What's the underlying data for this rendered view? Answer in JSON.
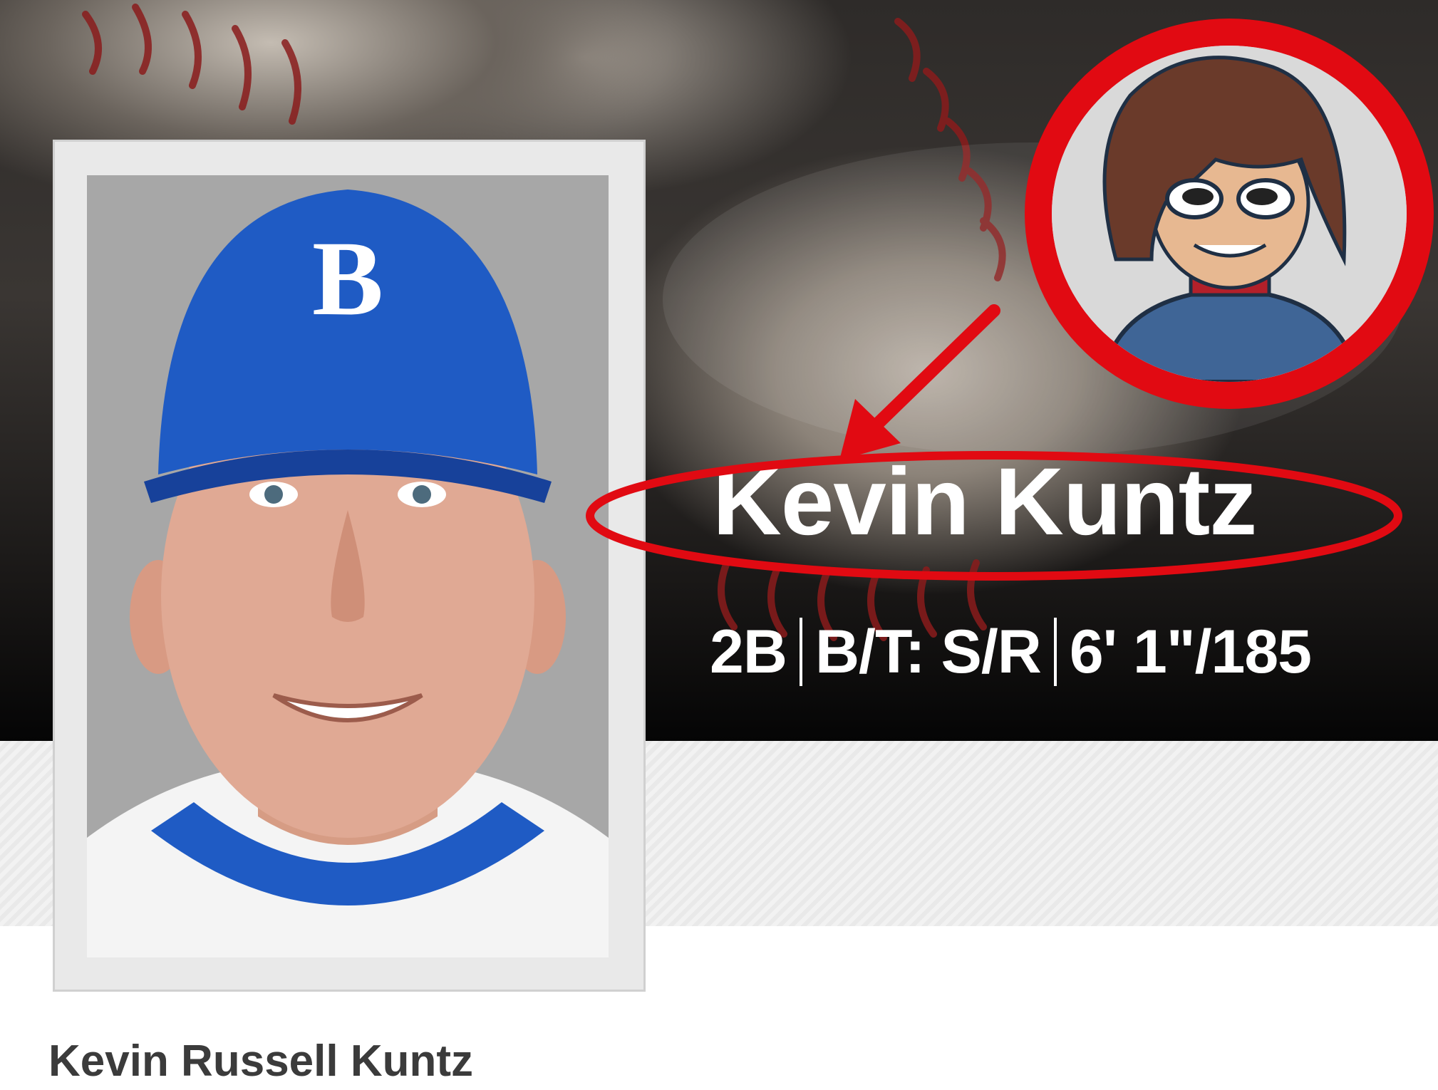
{
  "player": {
    "display_name": "Kevin Kuntz",
    "position": "2B",
    "bats_throws": "B/T: S/R",
    "height_weight": "6' 1\"/185",
    "full_name": "Kevin Russell Kuntz",
    "cap_letter": "B"
  },
  "colors": {
    "annotation_red": "#e10a12",
    "cap_blue": "#1f5bc4",
    "name_text": "#ffffff"
  },
  "icons": {
    "avatar": "cartoon-avatar-icon",
    "arrow": "red-arrow-icon"
  }
}
